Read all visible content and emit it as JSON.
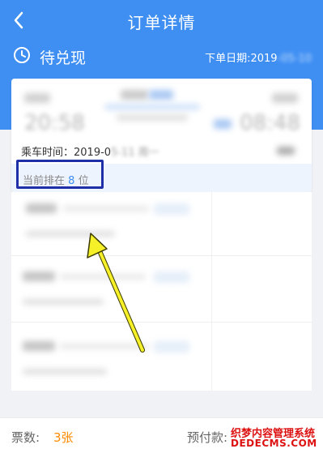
{
  "nav": {
    "title": "订单详情"
  },
  "status": {
    "label": "待兑现",
    "order_date_prefix": "下单日期:2019",
    "order_date_rest": "-05-10"
  },
  "trip": {
    "departure_time": "20:58",
    "arrival_time": "08:48",
    "ride_time_prefix": "乘车时间：2019-0",
    "ride_time_rest": "5-11 周一",
    "queue_prefix": "当前排在",
    "queue_position": "8",
    "queue_suffix": "位"
  },
  "footer": {
    "tickets_label": "票数:",
    "tickets_value": "3张",
    "prepay_label": "预付款:",
    "watermark_line1": "织梦内容管理系统",
    "watermark_line2": "DEDECMS.COM"
  },
  "colors": {
    "header_blue": "#3f8ff3",
    "highlight_box": "#1e2fa8",
    "annotation_arrow": "#f5f028",
    "ticket_orange": "#ff8a00"
  }
}
